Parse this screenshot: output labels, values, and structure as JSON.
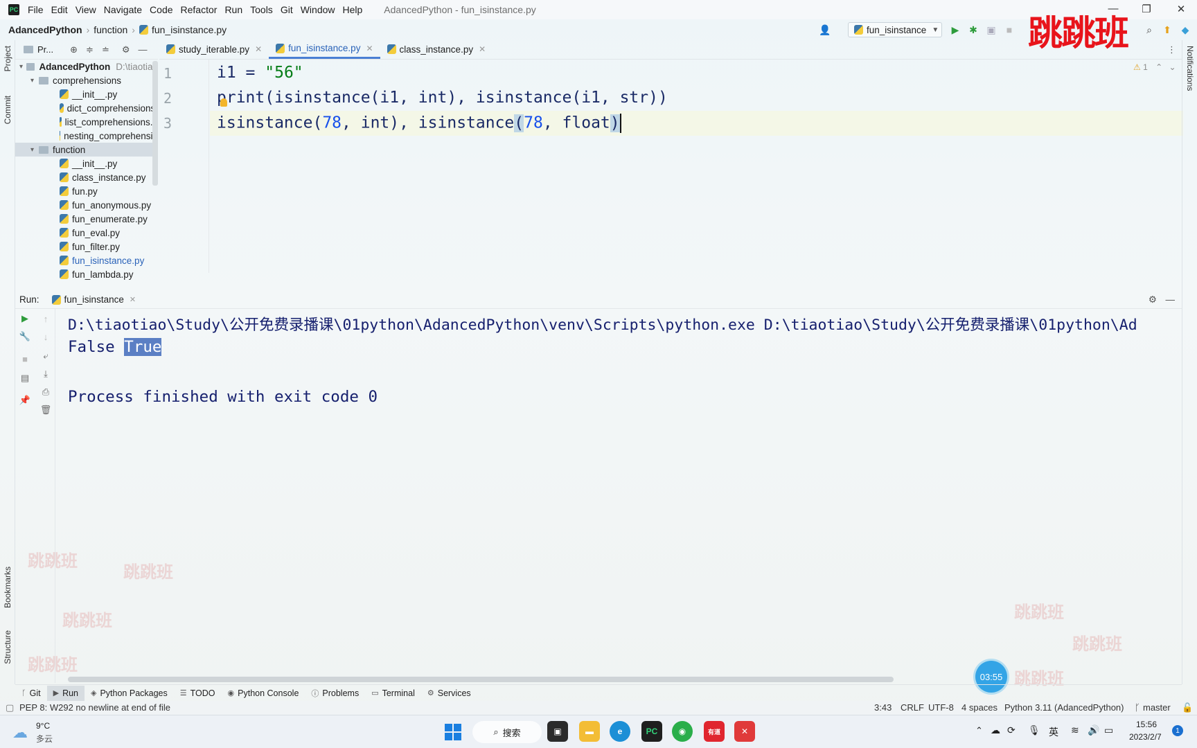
{
  "menubar": {
    "items": [
      "File",
      "Edit",
      "View",
      "Navigate",
      "Code",
      "Refactor",
      "Run",
      "Tools",
      "Git",
      "Window",
      "Help"
    ],
    "window_title": "AdancedPython - fun_isinstance.py"
  },
  "watermark": "跳跳班",
  "navbar": {
    "project": "AdancedPython",
    "folder": "function",
    "file": "fun_isinstance.py",
    "run_config": "fun_isinstance"
  },
  "left_stripe": {
    "project": "Project",
    "commit": "Commit",
    "bookmarks": "Bookmarks",
    "structure": "Structure"
  },
  "right_stripe": {
    "notifications": "Notifications"
  },
  "project_panel": {
    "header": "Pr...",
    "root_name": "AdancedPython",
    "root_path": "D:\\tiaotiao",
    "items": [
      {
        "label": "comprehensions"
      },
      {
        "label": "__init__.py"
      },
      {
        "label": "dict_comprehensions."
      },
      {
        "label": "list_comprehensions.p"
      },
      {
        "label": "nesting_comprehensio"
      },
      {
        "label": "function"
      },
      {
        "label": "__init__.py"
      },
      {
        "label": "class_instance.py"
      },
      {
        "label": "fun.py"
      },
      {
        "label": "fun_anonymous.py"
      },
      {
        "label": "fun_enumerate.py"
      },
      {
        "label": "fun_eval.py"
      },
      {
        "label": "fun_filter.py"
      },
      {
        "label": "fun_isinstance.py"
      },
      {
        "label": "fun_lambda.py"
      }
    ]
  },
  "tabs": [
    {
      "label": "study_iterable.py"
    },
    {
      "label": "fun_isinstance.py"
    },
    {
      "label": "class_instance.py"
    }
  ],
  "editor": {
    "line_numbers": [
      "1",
      "2",
      "3"
    ],
    "line1": {
      "var": "i1 = ",
      "str": "\"56\""
    },
    "line2": "print(isinstance(i1, int), isinstance(i1, str))",
    "line3": {
      "a": "isinstance(",
      "n1": "78",
      "b": ", int), isinstance",
      "p1": "(",
      "n2": "78",
      "c": ", float",
      "p2": ")"
    },
    "warnings": "1"
  },
  "run": {
    "label": "Run:",
    "tab": "fun_isinstance",
    "cmd": "D:\\tiaotiao\\Study\\公开免费录播课\\01python\\AdancedPython\\venv\\Scripts\\python.exe D:\\tiaotiao\\Study\\公开免费录播课\\01python\\Ad",
    "out_false": "False ",
    "out_true": "True",
    "finished": "Process finished with exit code 0"
  },
  "timer": "03:55",
  "tool_tabs": [
    "Git",
    "Run",
    "Python Packages",
    "TODO",
    "Python Console",
    "Problems",
    "Terminal",
    "Services"
  ],
  "status": {
    "message": "PEP 8: W292 no newline at end of file",
    "position": "3:43",
    "line_sep": "CRLF",
    "encoding": "UTF-8",
    "indent": "4 spaces",
    "interpreter": "Python 3.11 (AdancedPython)",
    "branch": "master"
  },
  "taskbar": {
    "weather_temp": "9°C",
    "weather_desc": "多云",
    "search": "搜索",
    "ime": "英",
    "time": "15:56",
    "date": "2023/2/7",
    "badge": "1"
  },
  "colors": {
    "accent": "#4a7fd4",
    "watermark": "#e8141b",
    "string": "#067d17",
    "number": "#1750eb"
  }
}
